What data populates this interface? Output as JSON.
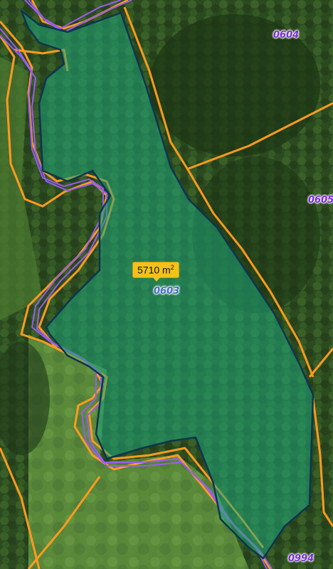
{
  "map": {
    "area_badge": {
      "value": "5710 m",
      "unit_sup": "2"
    },
    "parcels": [
      {
        "id": "0603",
        "selected": true
      },
      {
        "id": "0604",
        "selected": false
      },
      {
        "id": "0605",
        "selected": false
      },
      {
        "id": "0994",
        "selected": false
      }
    ]
  },
  "colors": {
    "parcel_boundary": "#ff9a1f",
    "road_lines": "#9b5cf0",
    "selection_fill": "#1fa67a",
    "selection_outline": "#0d3550",
    "badge_bg": "#f3c21a"
  }
}
